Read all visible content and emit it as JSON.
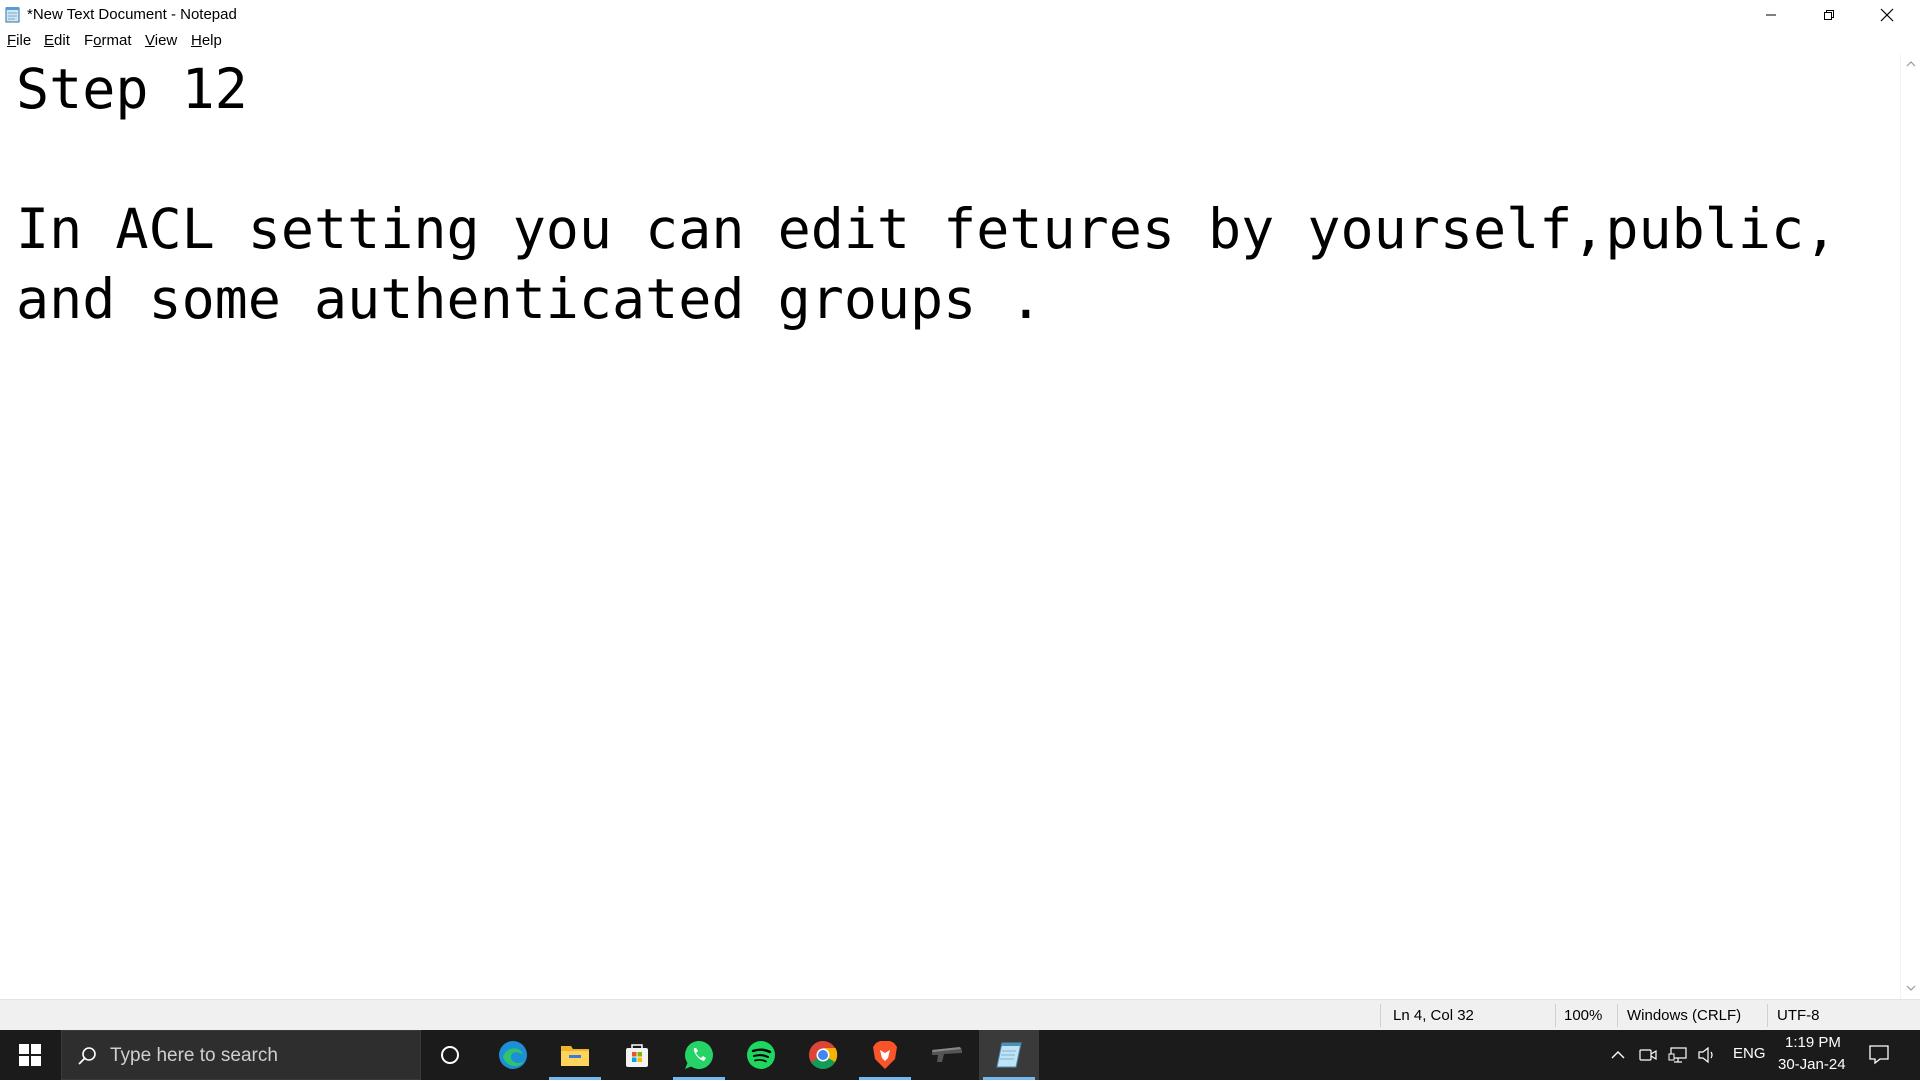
{
  "window": {
    "title": "*New Text Document - Notepad",
    "controls": {
      "minimize": "minimize",
      "maximize": "restore",
      "close": "close"
    }
  },
  "menu": {
    "items": [
      {
        "accel": "F",
        "rest": "ile"
      },
      {
        "accel": "E",
        "rest": "dit"
      },
      {
        "accel": "o",
        "pre": "F",
        "rest": "rmat"
      },
      {
        "accel": "V",
        "rest": "iew"
      },
      {
        "accel": "H",
        "rest": "elp"
      }
    ]
  },
  "editor": {
    "text": "Step 12\n\nIn ACL setting you can edit fetures by yourself,public,\nand some authenticated groups ."
  },
  "status": {
    "position": "Ln 4, Col 32",
    "zoom": "100%",
    "line_ending": "Windows (CRLF)",
    "encoding": "UTF-8"
  },
  "taskbar": {
    "search_placeholder": "Type here to search",
    "apps": [
      "cortana-icon",
      "edge-icon",
      "file-explorer-icon",
      "microsoft-store-icon",
      "whatsapp-icon",
      "spotify-icon",
      "chrome-icon",
      "brave-icon",
      "gun-app-icon",
      "notepad-icon"
    ],
    "tray": {
      "language": "ENG",
      "time": "1:19 PM",
      "date": "30-Jan-24"
    }
  },
  "colors": {
    "taskbar_bg": "#1b1b1b",
    "active_indicator": "#76b9ed",
    "statusbar_bg": "#f0f0f0"
  }
}
